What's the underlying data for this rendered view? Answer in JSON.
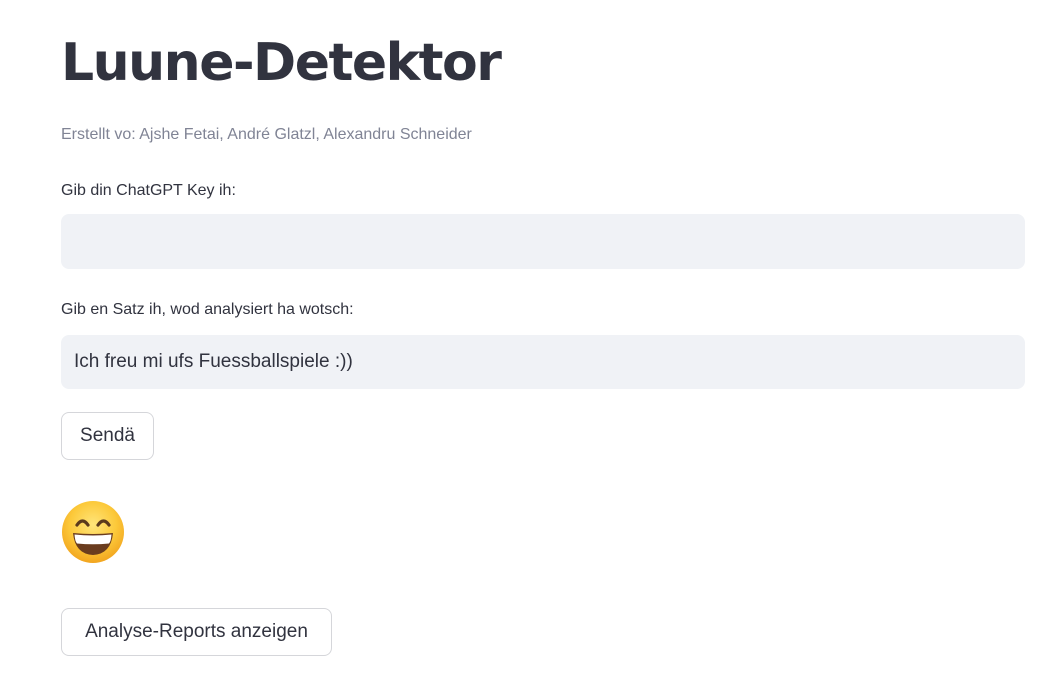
{
  "app": {
    "title": "Luune-Detektor",
    "caption": "Erstellt vo: Ajshe Fetai, André Glatzl, Alexandru Schneider"
  },
  "key_field": {
    "label": "Gib din ChatGPT Key ih:",
    "value": ""
  },
  "sentence_field": {
    "label": "Gib en Satz ih, wod analysiert ha wotsch:",
    "value": "Ich freu mi ufs Fuessballspiele :))"
  },
  "send_button": {
    "label": "Sendä"
  },
  "result": {
    "icon": "grinning-face-icon"
  },
  "report_button": {
    "label": "Analyse-Reports anzeigen"
  },
  "colors": {
    "text": "#31333f",
    "caption": "#808495",
    "input_bg": "#f0f2f6",
    "button_border": "#d5d6da"
  }
}
